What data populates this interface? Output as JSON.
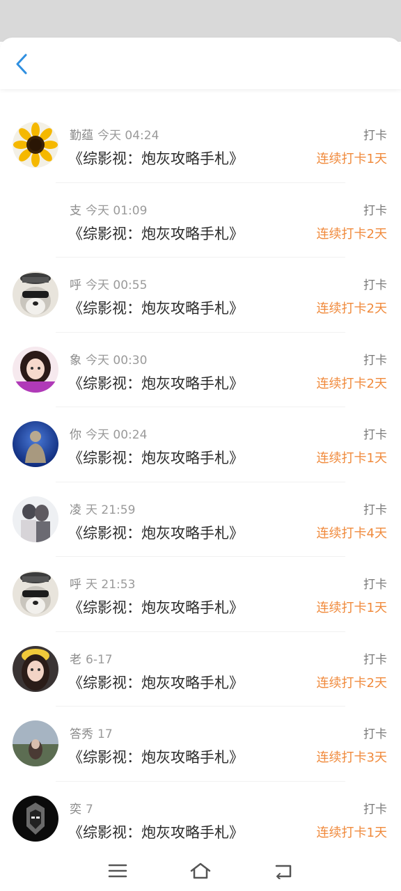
{
  "header": {
    "back_icon": "chevron-left-icon",
    "accent": "#2f8fe0"
  },
  "entries": [
    {
      "avatar": "sunflower",
      "name": "勤蕴",
      "time": "今天 04:24",
      "title": "《综影视：炮灰攻略手札》",
      "action": "打卡",
      "streak": "连续打卡1天"
    },
    {
      "avatar": "none",
      "name": "支",
      "time": "今天 01:09",
      "title": "《综影视：炮灰攻略手札》",
      "action": "打卡",
      "streak": "连续打卡2天"
    },
    {
      "avatar": "husky",
      "name": "呼",
      "time": "今天 00:55",
      "title": "《综影视：炮灰攻略手札》",
      "action": "打卡",
      "streak": "连续打卡2天"
    },
    {
      "avatar": "girl-pink",
      "name": "象",
      "time": "今天 00:30",
      "title": "《综影视：炮灰攻略手札》",
      "action": "打卡",
      "streak": "连续打卡2天"
    },
    {
      "avatar": "buddha",
      "name": "你",
      "time": "今天 00:24",
      "title": "《综影视：炮灰攻略手札》",
      "action": "打卡",
      "streak": "连续打卡1天"
    },
    {
      "avatar": "couple-sketch",
      "name": "凌",
      "time": "天 21:59",
      "title": "《综影视：炮灰攻略手札》",
      "action": "打卡",
      "streak": "连续打卡4天"
    },
    {
      "avatar": "husky",
      "name": "呼",
      "time": "天 21:53",
      "title": "《综影视：炮灰攻略手札》",
      "action": "打卡",
      "streak": "连续打卡1天"
    },
    {
      "avatar": "girl-yellow-hat",
      "name": "老",
      "time": "6-17",
      "title": "《综影视：炮灰攻略手札》",
      "action": "打卡",
      "streak": "连续打卡2天"
    },
    {
      "avatar": "girl-landscape",
      "name": "答秀",
      "time": "17",
      "title": "《综影视：炮灰攻略手札》",
      "action": "打卡",
      "streak": "连续打卡3天"
    },
    {
      "avatar": "dark-mech",
      "name": "奕",
      "time": "7",
      "title": "《综影视：炮灰攻略手札》",
      "action": "打卡",
      "streak": "连续打卡1天"
    }
  ],
  "colors": {
    "streak": "#f08a3c",
    "title": "#2a2a2a",
    "meta": "#9a9a9a"
  },
  "navbar": {
    "menu_icon": "menu-icon",
    "home_icon": "home-icon",
    "back_icon": "back-icon"
  }
}
